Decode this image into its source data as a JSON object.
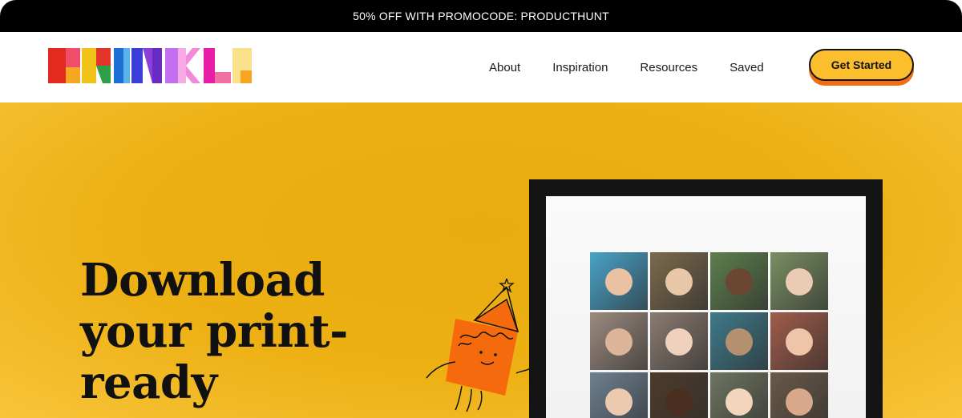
{
  "promo": {
    "text": "50% OFF WITH PROMOCODE: PRODUCTHUNT"
  },
  "header": {
    "logo_text": "PRINKL",
    "nav": [
      {
        "label": "About"
      },
      {
        "label": "Inspiration"
      },
      {
        "label": "Resources"
      },
      {
        "label": "Saved"
      }
    ],
    "cta_label": "Get Started"
  },
  "hero": {
    "headline_lines": [
      "Download",
      "your print-",
      "ready"
    ],
    "background": "#edb114",
    "photos": [
      {
        "bg": "#4aa3c8",
        "face": "#e9c2a4"
      },
      {
        "bg": "#7b6a4c",
        "face": "#e8c6a8"
      },
      {
        "bg": "#5d7f4d",
        "face": "#6b4632"
      },
      {
        "bg": "#7a8f63",
        "face": "#eccbb4"
      },
      {
        "bg": "#9c8b80",
        "face": "#dcb49a"
      },
      {
        "bg": "#8a7b70",
        "face": "#f0d1bd"
      },
      {
        "bg": "#3e7a8a",
        "face": "#b4906f"
      },
      {
        "bg": "#a15c4a",
        "face": "#eec5a8"
      },
      {
        "bg": "#6f8191",
        "face": "#eccab0"
      },
      {
        "bg": "#4d3b2b",
        "face": "#4a2f21"
      },
      {
        "bg": "#6e7560",
        "face": "#f3d4bd"
      },
      {
        "bg": "#6a5a48",
        "face": "#d9a78a"
      }
    ]
  },
  "colors": {
    "accent": "#fbbf2d",
    "cta_shadow": "#f06d12",
    "mascot": "#f46a0c"
  }
}
